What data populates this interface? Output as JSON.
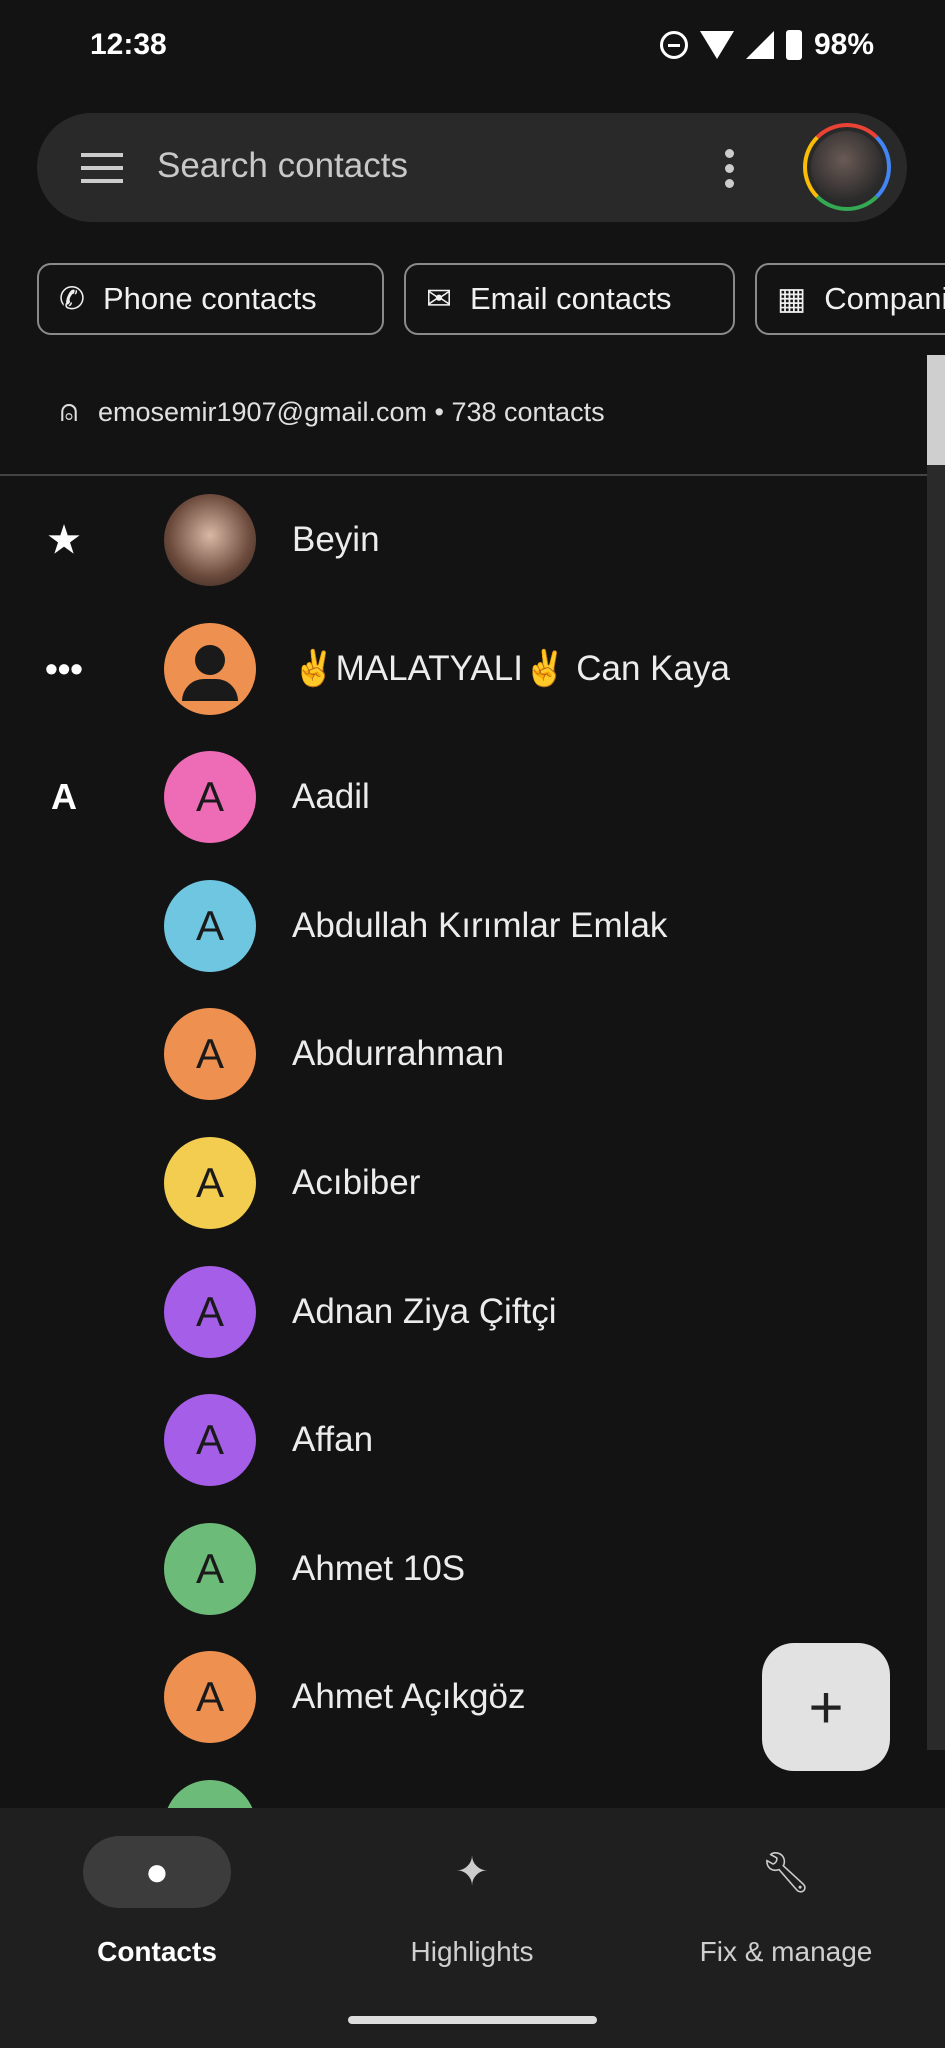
{
  "status": {
    "time": "12:38",
    "battery": "98%"
  },
  "search": {
    "placeholder": "Search contacts"
  },
  "chips": [
    {
      "label": "Phone contacts",
      "icon": "phone-icon"
    },
    {
      "label": "Email contacts",
      "icon": "mail-icon"
    },
    {
      "label": "Companies",
      "icon": "building-icon"
    }
  ],
  "account": {
    "text": "emosemir1907@gmail.com • 738 contacts"
  },
  "contacts": [
    {
      "section": "★",
      "name": "Beyin",
      "initial": "",
      "color": "#8a6a5a"
    },
    {
      "section": "•••",
      "name": "✌MALATYALI✌ Can Kaya",
      "initial": "",
      "color": "#ee9150"
    },
    {
      "section": "A",
      "name": "Aadil",
      "initial": "A",
      "color": "#ee6bb5"
    },
    {
      "section": "",
      "name": "Abdullah Kırımlar Emlak",
      "initial": "A",
      "color": "#6ec6e0"
    },
    {
      "section": "",
      "name": "Abdurrahman",
      "initial": "A",
      "color": "#ee9150"
    },
    {
      "section": "",
      "name": "Acıbiber",
      "initial": "A",
      "color": "#f2cd4f"
    },
    {
      "section": "",
      "name": "Adnan Ziya Çiftçi",
      "initial": "A",
      "color": "#a45ee8"
    },
    {
      "section": "",
      "name": "Affan",
      "initial": "A",
      "color": "#a45ee8"
    },
    {
      "section": "",
      "name": "Ahmet 10S",
      "initial": "A",
      "color": "#6dbb78"
    },
    {
      "section": "",
      "name": "Ahmet Açıkgöz",
      "initial": "A",
      "color": "#ee9150"
    },
    {
      "section": "",
      "name": "",
      "initial": "",
      "color": "#6dbb78"
    }
  ],
  "fab": {
    "label": "+"
  },
  "nav": [
    {
      "label": "Contacts",
      "active": true
    },
    {
      "label": "Highlights"
    },
    {
      "label": "Fix & manage"
    }
  ]
}
